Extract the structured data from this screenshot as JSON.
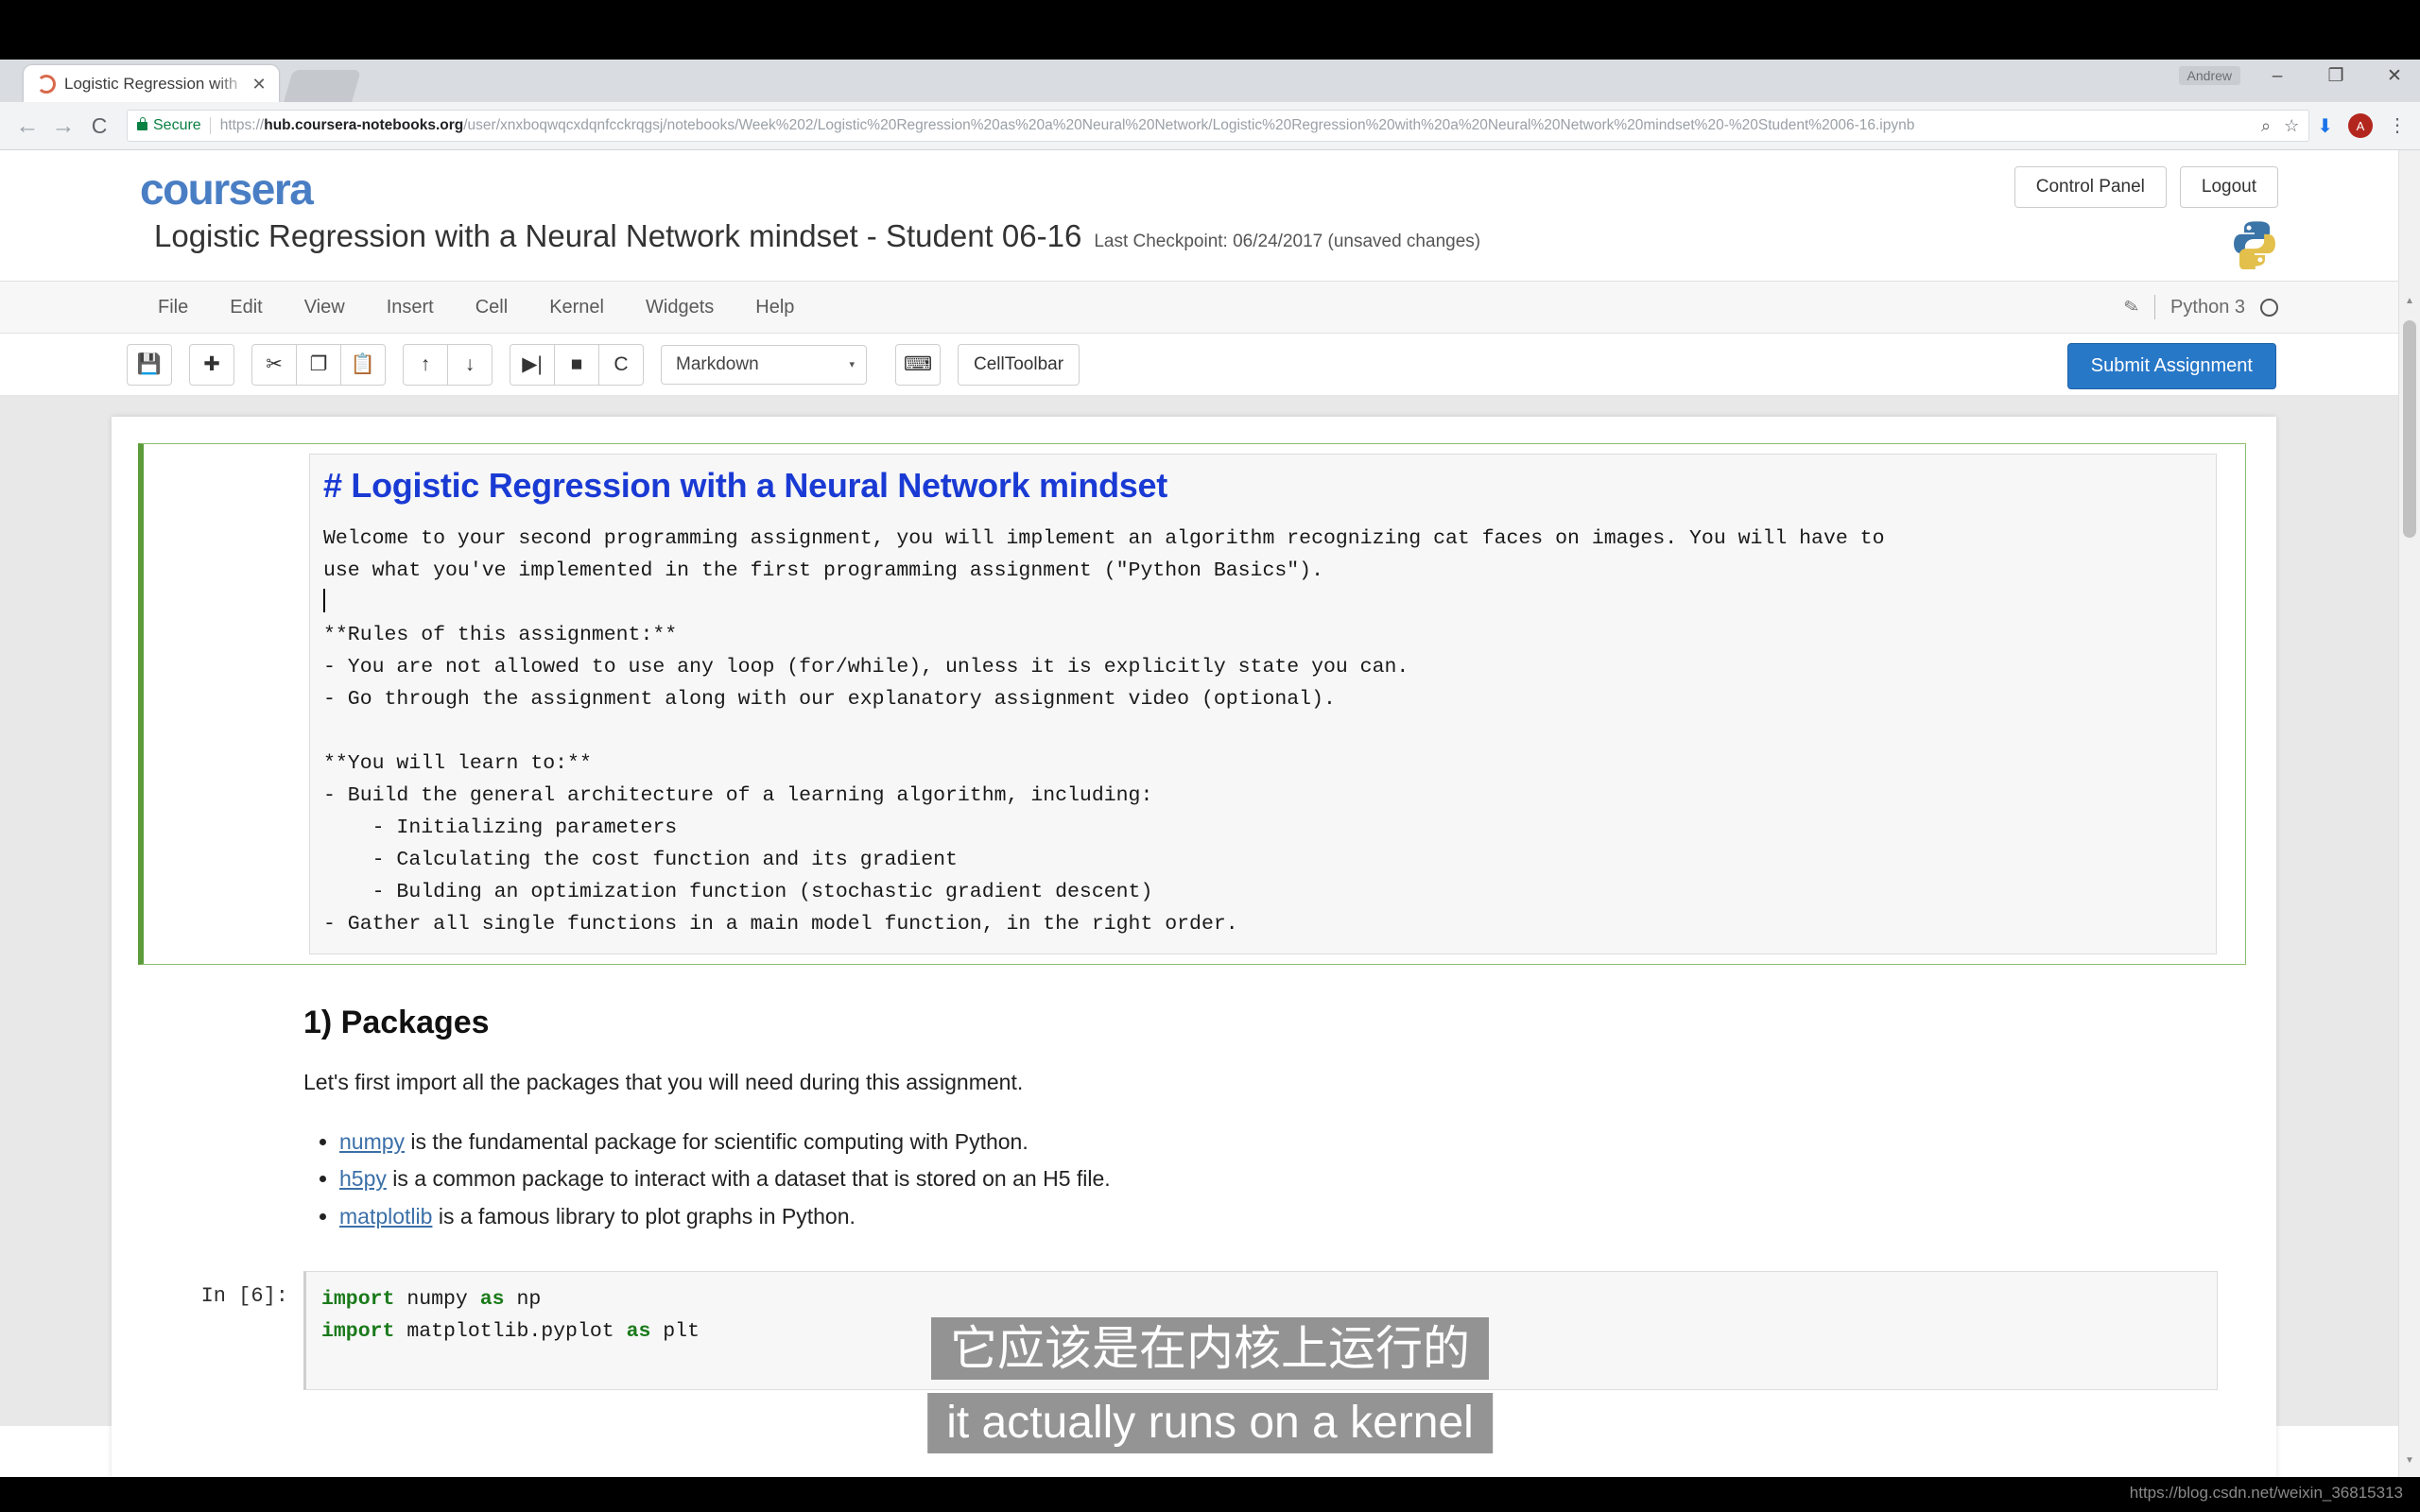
{
  "browser": {
    "tab": {
      "title": "Logistic Regression with",
      "close_label": "✕",
      "favicon": "coursera-favicon"
    },
    "window_controls": {
      "minimize": "–",
      "maximize": "❐",
      "close": "✕",
      "user_chip": "Andrew"
    },
    "nav": {
      "back": "←",
      "forward": "→",
      "reload": "C",
      "download": "⬇",
      "avatar": "A",
      "menu": "⋮"
    },
    "omnibox": {
      "secure_label": "Secure",
      "url_bold": "hub.coursera-notebooks.org",
      "url_prefix": "https://",
      "url_rest": "/user/xnxboqwqcxdqnfcckrqgsj/notebooks/Week%202/Logistic%20Regression%20as%20a%20Neural%20Network/Logistic%20Regression%20with%20a%20Neural%20Network%20mindset%20-%20Student%2006-16.ipynb",
      "zoom_icon": "⌕",
      "bookmark_icon": "☆"
    }
  },
  "notebook": {
    "logo_text": "coursera",
    "title": "Logistic Regression with a Neural Network mindset - Student 06-16",
    "checkpoint": "Last Checkpoint: 06/24/2017 (unsaved changes)",
    "header_buttons": [
      "Control Panel",
      "Logout"
    ],
    "menus": [
      "File",
      "Edit",
      "View",
      "Insert",
      "Cell",
      "Kernel",
      "Widgets",
      "Help"
    ],
    "kernel_name": "Python 3",
    "kernel_status": "idle",
    "toolbar": {
      "save": "💾",
      "insert_below": "✚",
      "cut": "✂",
      "copy": "❐",
      "paste": "📋",
      "move_up": "↑",
      "move_down": "↓",
      "run": "▶|",
      "stop": "■",
      "restart": "C",
      "cell_type": "Markdown",
      "caret": "▾",
      "command_palette": "⌨",
      "cell_toolbar": "CellToolbar",
      "submit": "Submit Assignment"
    },
    "markdown_cell": {
      "heading": "# Logistic Regression with a Neural Network mindset",
      "lines": [
        "Welcome to your second programming assignment, you will implement an algorithm recognizing cat faces on images. You will have to",
        "use what you've implemented in the first programming assignment (\"Python Basics\").",
        "",
        "**Rules of this assignment:**",
        "- You are not allowed to use any loop (for/while), unless it is explicitly state you can.",
        "- Go through the assignment along with our explanatory assignment video (optional).",
        "",
        "**You will learn to:**",
        "- Build the general architecture of a learning algorithm, including:",
        "    - Initializing parameters",
        "    - Calculating the cost function and its gradient",
        "    - Bulding an optimization function (stochastic gradient descent)",
        "- Gather all single functions in a main model function, in the right order."
      ]
    },
    "packages_section": {
      "heading": "1) Packages",
      "intro": "Let's first import all the packages that you will need during this assignment.",
      "bullets": [
        {
          "link": "numpy",
          "text": " is the fundamental package for scientific computing with Python."
        },
        {
          "link": "h5py",
          "text": " is a common package to interact with a dataset that is stored on an H5 file."
        },
        {
          "link": "matplotlib",
          "text": " is a famous library to plot graphs in Python."
        }
      ]
    },
    "code_cell": {
      "prompt": "In [6]:",
      "lines": [
        {
          "kw1": "import",
          "rest1": " numpy ",
          "kw2": "as",
          "rest2": " np"
        },
        {
          "kw1": "import",
          "rest1": " matplotlib.pyplot ",
          "kw2": "as",
          "rest2": " plt"
        }
      ]
    }
  },
  "subtitles": {
    "chinese": "它应该是在内核上运行的",
    "english": "it actually runs on a kernel"
  },
  "watermark": "https://blog.csdn.net/weixin_36815313",
  "colors": {
    "coursera_blue": "#4a7ec4",
    "submit_blue": "#2878c8",
    "secure_green": "#0b8043",
    "selected_cell_green": "#5c9c3a",
    "md_heading_blue": "#1a3ad4"
  }
}
